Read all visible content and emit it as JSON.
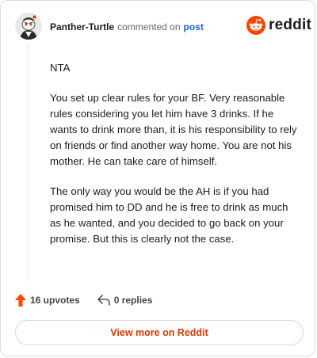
{
  "header": {
    "username": "Panther-Turtle",
    "commented_text": "commented on",
    "post_link": "post",
    "brand_word": "reddit"
  },
  "comment": {
    "paragraphs": [
      "NTA",
      "You set up clear rules for your BF. Very reasonable rules considering you let him have 3 drinks. If he wants to drink more than, it is his responsibility to rely on friends or find another way home. You are not his mother. He can take care of himself.",
      "The only way you would be the AH is if you had promised him to DD and he is free to drink as much as he wanted, and you decided to go back on your promise. But this is clearly not the case."
    ]
  },
  "actions": {
    "upvotes": "16 upvotes",
    "replies": "0 replies"
  },
  "footer": {
    "view_more_label": "View more on Reddit"
  },
  "icons": {
    "upvote": "upvote-arrow-icon",
    "reply": "reply-arrow-icon",
    "brand": "reddit-snoo-icon",
    "avatar": "user-avatar-icon"
  },
  "colors": {
    "brand_orange": "#ff4500",
    "link_blue": "#1a5fd1",
    "view_more_text": "#d93a00"
  }
}
